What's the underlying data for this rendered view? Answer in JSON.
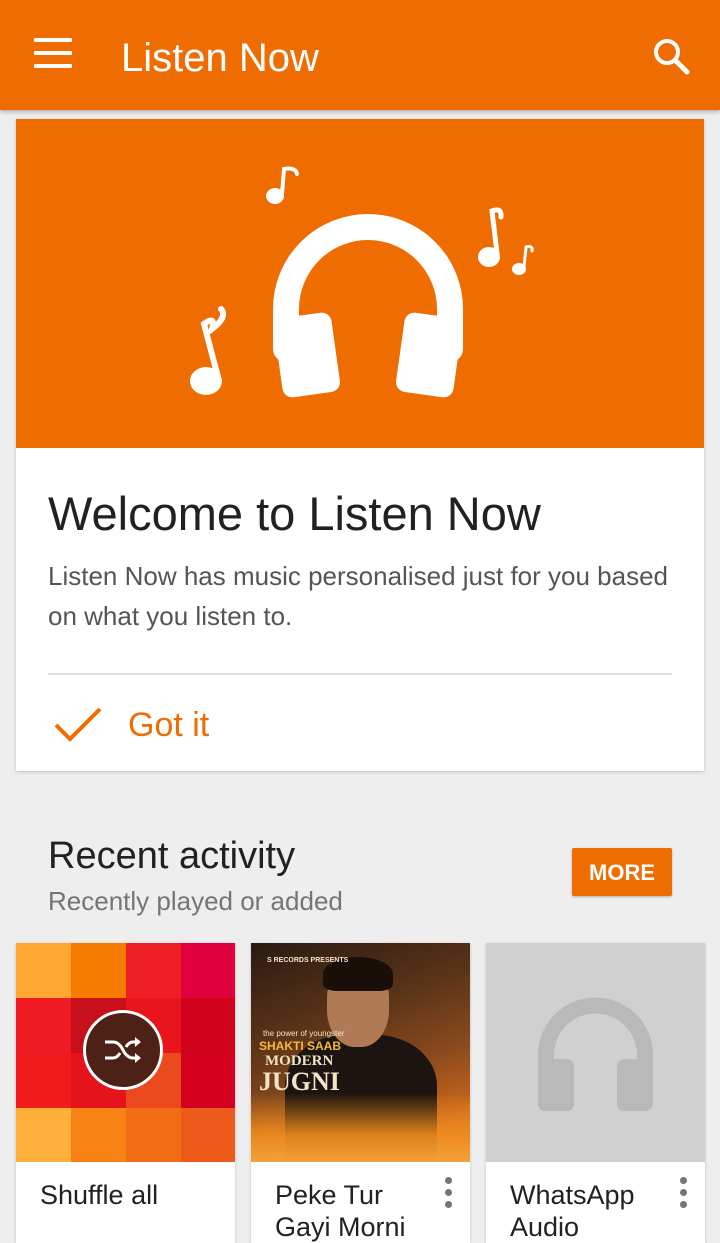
{
  "app_bar": {
    "title": "Listen Now",
    "background": "#ef6c00",
    "menu_icon": "hamburger-menu-icon",
    "search_icon": "search-icon"
  },
  "welcome_card": {
    "hero_icon": "headphones-with-music-notes-icon",
    "title": "Welcome to Listen Now",
    "body": "Listen Now has music personalised just for you based on what you listen to.",
    "action_label": "Got it",
    "action_icon": "check-icon"
  },
  "recent_activity": {
    "title": "Recent activity",
    "subtitle": "Recently played or added",
    "more_label": "MORE",
    "items": [
      {
        "label": "Shuffle all",
        "art": "color-mosaic",
        "icon": "shuffle-icon"
      },
      {
        "label": "Peke Tur Gayi Morni",
        "art": "album-cover",
        "cover_text": {
          "publisher": "S RECORDS PRESENTS",
          "tagline": "the power of youngster",
          "artist": "SHAKTI SAAB",
          "album_line1": "MODERN",
          "album_line2": "JUGNI"
        },
        "icon": "more-vert-icon"
      },
      {
        "label": "WhatsApp Audio",
        "art": "placeholder",
        "art_icon": "headphones-icon",
        "icon": "more-vert-icon"
      }
    ]
  },
  "colors": {
    "accent": "#ef6c00",
    "mosaic": [
      "#ffa733",
      "#f57c00",
      "#ef1d24",
      "#e0003d",
      "#f01c24",
      "#c8101c",
      "#e8151c",
      "#d0021b",
      "#f21b1b",
      "#e4131c",
      "#ea4a1d",
      "#d5001f",
      "#ffb03b",
      "#f88214",
      "#f26c16",
      "#ee5a1a"
    ]
  }
}
